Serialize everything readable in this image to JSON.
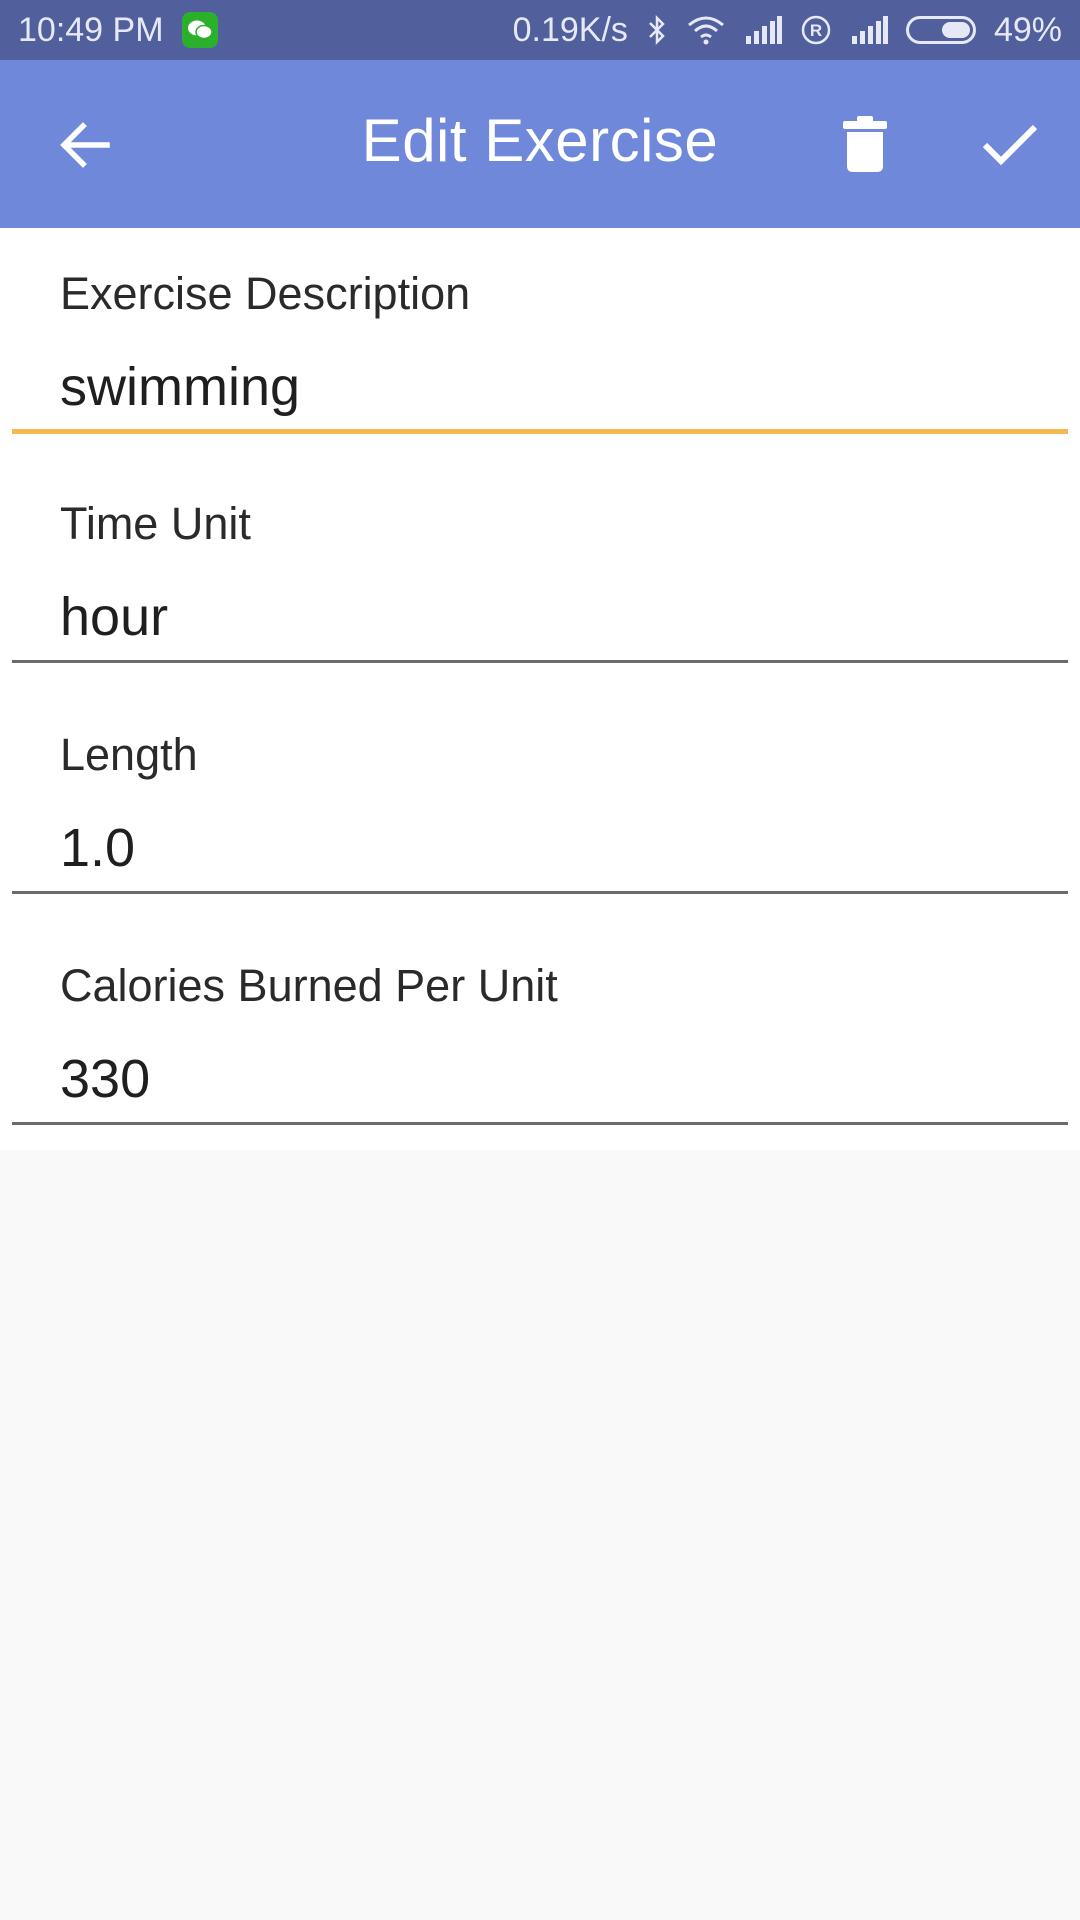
{
  "status_bar": {
    "time": "10:49 PM",
    "network_speed": "0.19K/s",
    "battery": "49%",
    "battery_level": 0.49,
    "icons": [
      "wechat-icon",
      "bluetooth-icon",
      "wifi-icon",
      "signal-icon",
      "roaming-icon",
      "signal-icon",
      "battery-icon"
    ]
  },
  "app_bar": {
    "title": "Edit Exercise",
    "back_icon": "arrow-left-icon",
    "delete_icon": "trash-icon",
    "confirm_icon": "check-icon",
    "color": "#6f88d9"
  },
  "form": {
    "fields": [
      {
        "label": "Exercise Description",
        "value": "swimming",
        "active": true
      },
      {
        "label": "Time Unit",
        "value": "hour",
        "active": false
      },
      {
        "label": "Length",
        "value": "1.0",
        "active": false
      },
      {
        "label": "Calories Burned Per Unit",
        "value": "330",
        "active": false
      }
    ],
    "active_underline_color": "#f6b94f"
  }
}
